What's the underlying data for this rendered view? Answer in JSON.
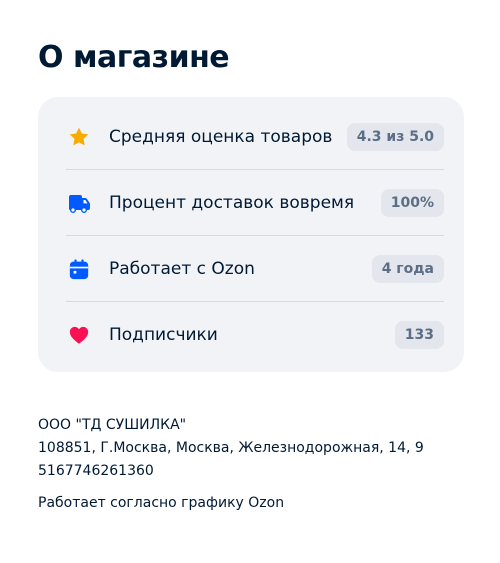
{
  "page": {
    "title": "О магазине"
  },
  "stats": {
    "items": [
      {
        "icon": "star-icon",
        "label": "Средняя оценка товаров",
        "value": "4.3 из 5.0",
        "color": "#f9ab00"
      },
      {
        "icon": "delivery-truck-icon",
        "label": "Процент доставок вовремя",
        "value": "100%",
        "color": "#005bff"
      },
      {
        "icon": "calendar-icon",
        "label": "Работает с Ozon",
        "value": "4 года",
        "color": "#005bff"
      },
      {
        "icon": "heart-icon",
        "label": "Подписчики",
        "value": "133",
        "color": "#f91155"
      }
    ]
  },
  "seller_info": {
    "company": "ООО \"ТД СУШИЛКА\"",
    "address": "108851, Г.Москва, Москва, Железнодорожная, 14, 9",
    "ogrn": "5167746261360",
    "schedule": "Работает согласно графику Ozon"
  }
}
